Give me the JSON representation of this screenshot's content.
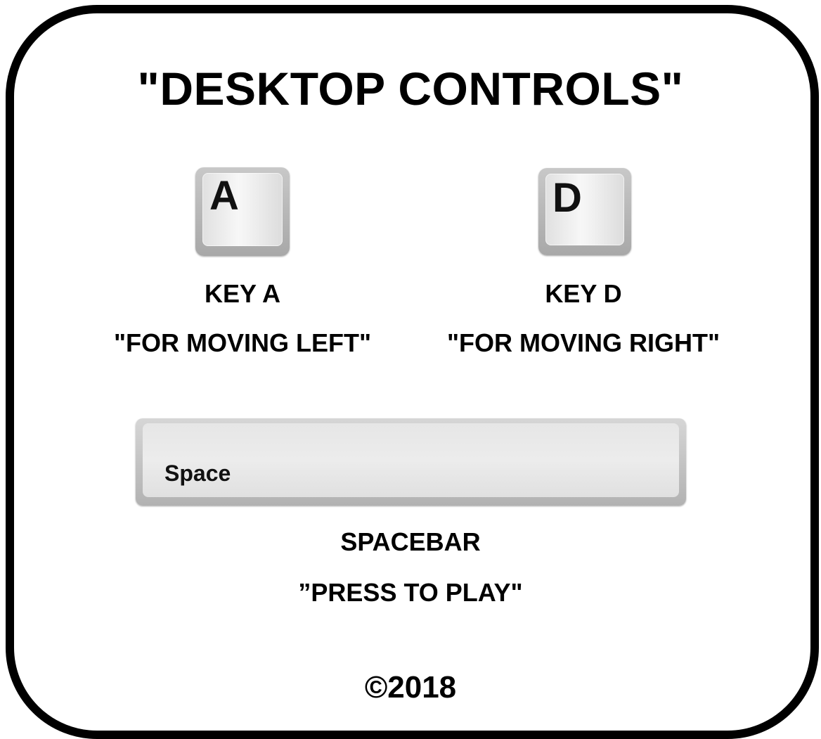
{
  "title": "\"DESKTOP CONTROLS\"",
  "keys": {
    "a": {
      "cap": "A",
      "name": "KEY A",
      "description": "\"FOR MOVING LEFT\""
    },
    "d": {
      "cap": "D",
      "name": "KEY D",
      "description": "\"FOR MOVING RIGHT\""
    },
    "space": {
      "cap": "Space",
      "name": "SPACEBAR",
      "description": "”PRESS TO PLAY\""
    }
  },
  "copyright": "©2018",
  "colors": {
    "border": "#000000",
    "background": "#ffffff",
    "key_base": "#b8b8b8",
    "key_cap": "#efefef"
  }
}
